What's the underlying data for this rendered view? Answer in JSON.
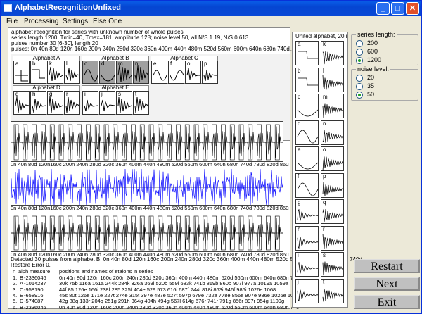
{
  "window": {
    "title": "AlphabetRecognitionUnfixed",
    "buttons": [
      "_",
      "□",
      "✕"
    ]
  },
  "menu": [
    "File",
    "Processing",
    "Settings",
    "Else One"
  ],
  "info_lines": [
    "alphabet recognition for series with unknown number of whole pulses",
    "series length 1200, Tmin=40, Tmax=181,  amplitude 128; noise level 50, all N/S 1.19,  N/S 0.613",
    "pulses number 30 [6-30], length 20",
    "pulses:  0n 40n 80d 120n 160c 200n 240n 280d 320c 360n 400m 440n 480m 520d 560m 600m 640n 680n 740d..."
  ],
  "alphabets": [
    {
      "label": "Alphabet A",
      "letters": [
        "a",
        "b",
        "k",
        "l"
      ]
    },
    {
      "label": "Alphabet B",
      "letters": [
        "c",
        "d",
        "m",
        "n"
      ]
    },
    {
      "label": "Alphabet C",
      "letters": [
        "e",
        "f",
        "o",
        "p"
      ]
    },
    {
      "label": "Alphabet D",
      "letters": [
        "g",
        "h",
        "q",
        "r"
      ]
    },
    {
      "label": "Alphabet E",
      "letters": [
        "i",
        "j",
        "s",
        "t"
      ]
    }
  ],
  "axis_labels": "0n 40n 80d 120n160c 200n 240n 280d 320c 360n 400m 440n 480m 520d 560m 600m 640n 680n 740d 780d 820d 860n 900m 940m 980n 1020d 1060n 1100 1140 1180c",
  "detected_text": "Detected 30 pulses from alphabet B:   0n 40n 80d 120n 160c 200n 240n 280d 320c 360n 400m 440n 480m 520d 560m 600m 640n 680n 740d",
  "restore_error": "Restore Error 0.",
  "results_header": {
    "n": "n",
    "alph": "alph",
    "measure": "measure",
    "positions": "positions and names of etalons in series"
  },
  "results": [
    {
      "n": "1.",
      "alph": "B",
      "measure": "-2336046",
      "positions": "0n 40n 80d 120n 160c 200n 240n 280d 320c 360n 400m 440n 480m 520d 560m 600m 640n 680n 740"
    },
    {
      "n": "2.",
      "alph": "A",
      "measure": "-1014237",
      "positions": "30k 75b 116a 161a 244k 284k 326a 369l 520b 559l 683k 741b 819b 860b 907l 977a 1019a 1059a"
    },
    {
      "n": "3.",
      "alph": "C",
      "measure": "-958190",
      "positions": "44f 85 126e 166i 238f 285 325f 404e 529 573 616i 687f 744i 818i 863i 946f 986i 1026e 1068"
    },
    {
      "n": "4.",
      "alph": "E",
      "measure": "-658916",
      "positions": "45s 80t 126e 171e 227t 274e 315t 397e 487e 527t 597p 679e 732e 778e 856e 907e 986e 1026e 10"
    },
    {
      "n": "5.",
      "alph": "D",
      "measure": "-574087",
      "positions": "42g 88q 133r 204q 251g 291h 364g 404h 494g 567l 614g 676r 741r 791g 856r 897r 954g 1109g"
    },
    {
      "n": "6.",
      "alph": "B",
      "measure": "-2336046",
      "positions": "0n 40n 80d 120n 160c 200n 240n 280d 320c 360n 400m 440n 480m 520d 560m 600m 640n 680n 740"
    }
  ],
  "united_alphabet_title": "United alphabet, 20 iter",
  "united_letters": [
    [
      "a",
      "k"
    ],
    [
      "b",
      "l"
    ],
    [
      "c",
      "m"
    ],
    [
      "d",
      "n"
    ],
    [
      "e",
      "o"
    ],
    [
      "f",
      "p"
    ],
    [
      "g",
      "q"
    ],
    [
      "h",
      "r"
    ],
    [
      "i",
      "s"
    ],
    [
      "j",
      "t"
    ]
  ],
  "series_length": {
    "title": "series length:",
    "options": [
      "200",
      "600",
      "1200"
    ],
    "selected": "1200"
  },
  "noise_level": {
    "title": "noise level:",
    "options": [
      "20",
      "35",
      "50"
    ],
    "selected": "50"
  },
  "buttons": {
    "restart": "Restart",
    "next": "Next",
    "exit": "Exit"
  },
  "colors": {
    "title_bar": "#0a5ee8",
    "noise_signal": "#0000ff",
    "selected_alphabet": "#a0a0a0",
    "radio_dot": "#21a121"
  }
}
